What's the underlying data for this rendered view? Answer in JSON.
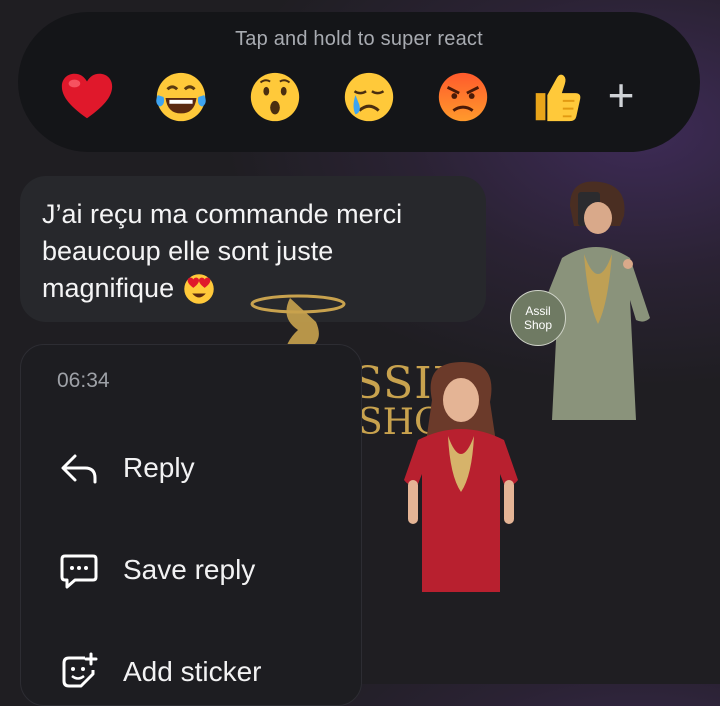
{
  "reactions": {
    "hint": "Tap and hold to super react",
    "emojis": [
      "heart-icon",
      "laughing-tears-icon",
      "surprised-icon",
      "crying-icon",
      "angry-icon",
      "thumbs-up-icon"
    ],
    "more": "+"
  },
  "message": {
    "text_line1": "J’ai reçu ma commande merci",
    "text_line2": "beaucoup elle sont juste",
    "text_line3": "magnifique",
    "emoji": "heart-eyes-icon"
  },
  "menu": {
    "time": "06:34",
    "items": [
      {
        "label": "Reply",
        "icon": "reply-arrow-icon"
      },
      {
        "label": "Save reply",
        "icon": "save-reply-icon"
      },
      {
        "label": "Add sticker",
        "icon": "add-sticker-icon"
      }
    ]
  },
  "overlay": {
    "logo_line1": "ASSIL",
    "logo_line2": "SHOP",
    "badge_line1": "Assil",
    "badge_line2": "Shop"
  },
  "colors": {
    "accent_gold": "#c8a24e",
    "dress_green": "#8a937b",
    "dress_red": "#b8202f"
  }
}
